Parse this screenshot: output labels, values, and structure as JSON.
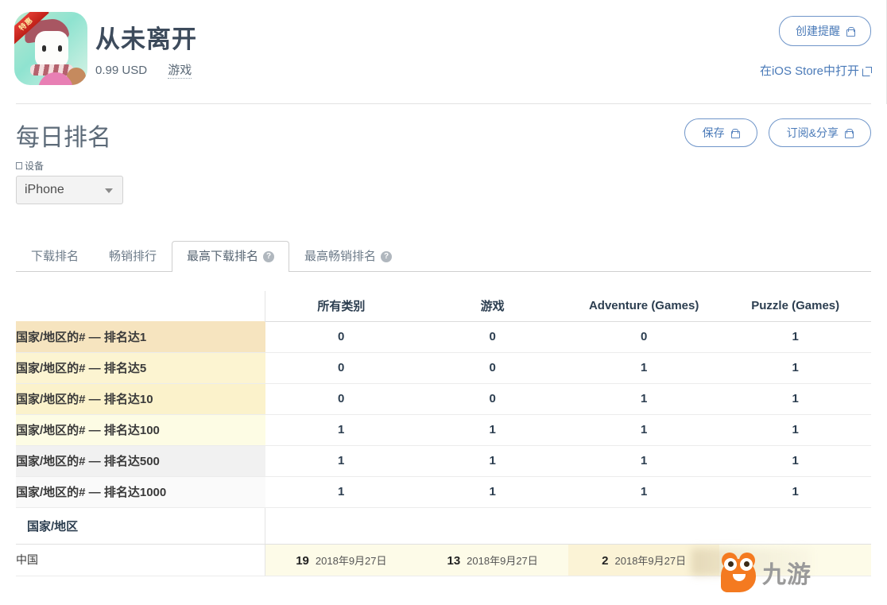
{
  "app": {
    "title": "从未离开",
    "price": "0.99 USD",
    "category": "游戏",
    "icon_badge": "特惠",
    "icon_name": "app-icon"
  },
  "header_actions": {
    "create_alert": "创建提醒",
    "open_store": "在iOS Store中打开",
    "lock_icon": "lock-icon",
    "external_icon": "external-link-icon"
  },
  "section": {
    "title": "每日排名",
    "save": "保存",
    "subscribe_share": "订阅&分享"
  },
  "filter": {
    "label": "设备",
    "value": "iPhone",
    "caret_icon": "chevron-down-icon",
    "checkbox_icon": "checkbox-icon"
  },
  "tabs": [
    {
      "label": "下载排名",
      "active": false,
      "help": false
    },
    {
      "label": "畅销排行",
      "active": false,
      "help": false
    },
    {
      "label": "最高下载排名",
      "active": true,
      "help": true
    },
    {
      "label": "最高畅销排名",
      "active": false,
      "help": true
    }
  ],
  "table": {
    "corner": "",
    "columns": [
      "所有类别",
      "游戏",
      "Adventure (Games)",
      "Puzzle (Games)"
    ],
    "rows": [
      {
        "label": "国家/地区的# — 排名达1",
        "values": [
          "0",
          "0",
          "0",
          "1"
        ],
        "bg": "#f6e4bf"
      },
      {
        "label": "国家/地区的# — 排名达5",
        "values": [
          "0",
          "0",
          "1",
          "1"
        ],
        "bg": "#fcf4d1"
      },
      {
        "label": "国家/地区的# — 排名达10",
        "values": [
          "0",
          "0",
          "1",
          "1"
        ],
        "bg": "#fbf2cb"
      },
      {
        "label": "国家/地区的# — 排名达100",
        "values": [
          "1",
          "1",
          "1",
          "1"
        ],
        "bg": "#fdfce4"
      },
      {
        "label": "国家/地区的# — 排名达500",
        "values": [
          "1",
          "1",
          "1",
          "1"
        ],
        "bg": "#f1f1f1"
      },
      {
        "label": "国家/地区的# — 排名达1000",
        "values": [
          "1",
          "1",
          "1",
          "1"
        ],
        "bg": "#fafafa"
      }
    ],
    "country_header": "国家/地区",
    "countries": [
      {
        "name": "中国",
        "cells": [
          {
            "rank": "19",
            "date": "2018年9月27日",
            "bg": "#fdfbe8"
          },
          {
            "rank": "13",
            "date": "2018年9月27日",
            "bg": "#fdfbe8"
          },
          {
            "rank": "2",
            "date": "2018年9月27日",
            "bg": "#fbf3d6"
          },
          {
            "rank": "",
            "date": "",
            "bg": "#fdfbe8"
          }
        ]
      }
    ]
  },
  "watermark": {
    "text": "九游",
    "mascot_icon": "mascot-icon"
  },
  "colors": {
    "accent_blue": "#4a7ab8",
    "title_slate": "#3d4b5c",
    "value_navy": "#2c3e50",
    "mascot_orange": "#f47a20"
  }
}
